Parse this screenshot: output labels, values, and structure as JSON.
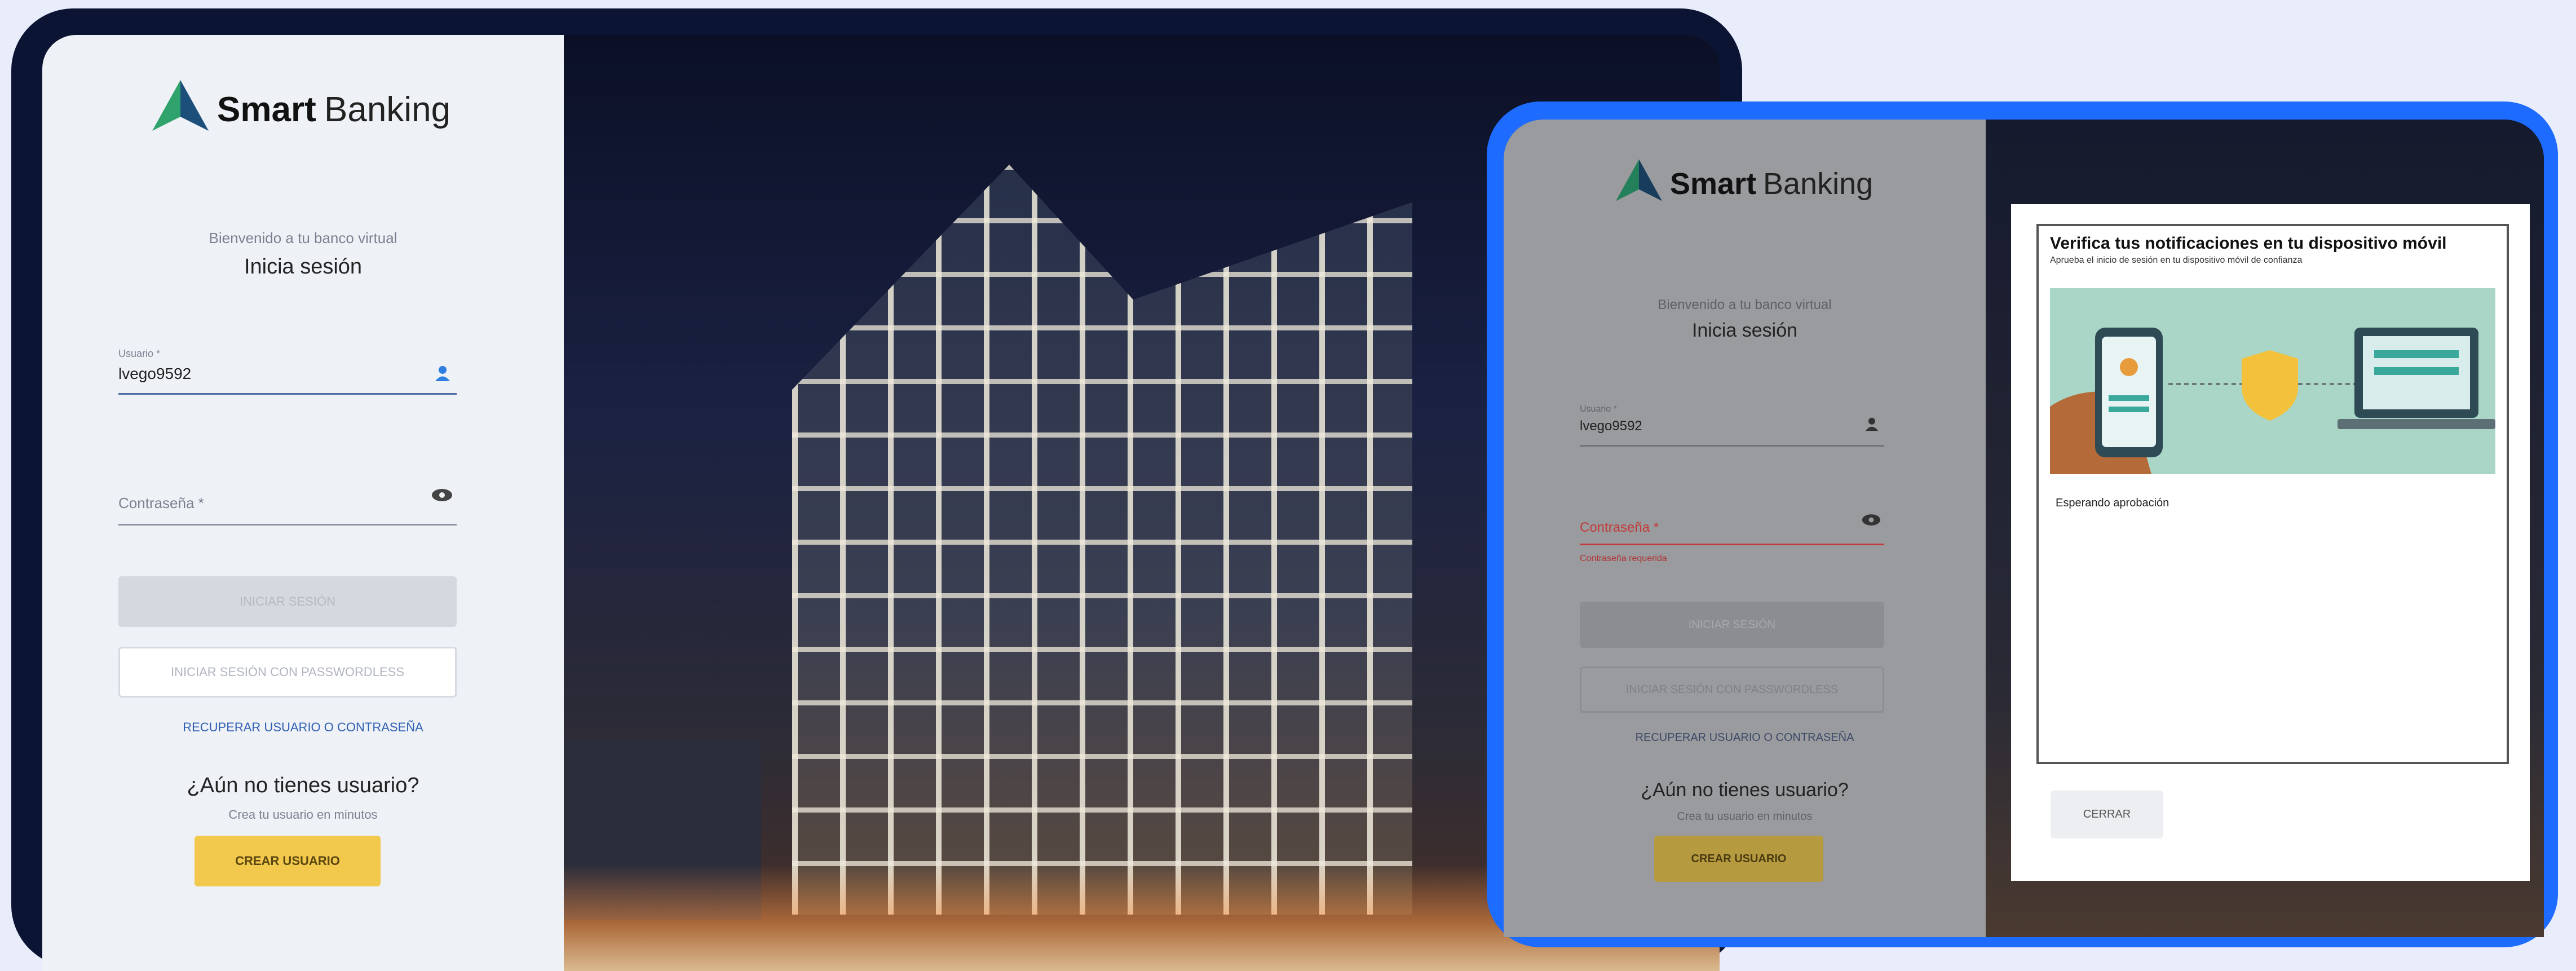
{
  "brand": {
    "name_bold": "Smart",
    "name_light": "Banking"
  },
  "login_left": {
    "welcome": "Bienvenido a tu banco virtual",
    "title": "Inicia sesión",
    "username_label": "Usuario *",
    "username_value": "lvego9592",
    "password_label": "Contraseña *",
    "login_button": "INICIAR SESIÓN",
    "passwordless_button": "INICIAR SESIÓN CON PASSWORDLESS",
    "recover_link": "RECUPERAR USUARIO O CONTRASEÑA",
    "no_user_title": "¿Aún no tienes usuario?",
    "no_user_subtitle": "Crea tu usuario en minutos",
    "create_button": "CREAR USUARIO"
  },
  "login_right": {
    "welcome": "Bienvenido a tu banco virtual",
    "title": "Inicia sesión",
    "username_label": "Usuario *",
    "username_value": "lvego9592",
    "password_label": "Contraseña *",
    "password_error": "Contraseña requerida",
    "login_button": "INICIAR SESIÓN",
    "passwordless_button": "INICIAR SESIÓN CON PASSWORDLESS",
    "recover_link": "RECUPERAR USUARIO O CONTRASEÑA",
    "no_user_title": "¿Aún no tienes usuario?",
    "no_user_subtitle": "Crea tu usuario en minutos",
    "create_button": "CREAR USUARIO"
  },
  "modal": {
    "title": "Verifica tus notificaciones en tu dispositivo móvil",
    "subtitle": "Aprueba el inicio de sesión en tu dispositivo móvil de confianza",
    "status": "Esperando aprobación",
    "close_button": "CERRAR"
  },
  "colors": {
    "frame_dark": "#0b1432",
    "frame_blue": "#1e6bff",
    "accent_yellow": "#f2c94c",
    "error_red": "#d93b3b",
    "link_blue": "#2f5fb3"
  },
  "icons": {
    "user": "user-icon",
    "eye": "eye-icon",
    "logo": "smart-banking-logo-icon"
  }
}
